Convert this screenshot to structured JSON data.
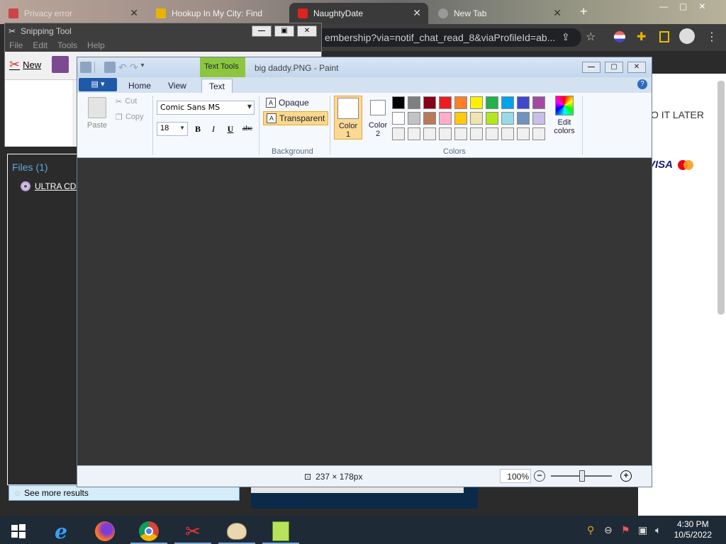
{
  "browser": {
    "tabs": [
      {
        "title": "Privacy error",
        "color": "#c44"
      },
      {
        "title": "Hookup In My City: Find",
        "color": "#e8b400"
      },
      {
        "title": "NaughtyDate",
        "color": "#d22"
      },
      {
        "title": "New Tab",
        "color": "#999"
      }
    ],
    "new_tab": "+",
    "url": "embership?via=notif_chat_read_8&viaProfileId=ab...",
    "page": {
      "later_text": "O IT LATER",
      "visa_text": "VISA"
    }
  },
  "snipping_tool": {
    "title": "Snipping Tool",
    "menu": [
      "File",
      "Edit",
      "Tools",
      "Help"
    ],
    "new_label": "New"
  },
  "start_search": {
    "files_heading": "Files (1)",
    "file_result": "ULTRA CD BLOATWARE",
    "more_results": "See more results"
  },
  "paint": {
    "title": "big daddy.PNG - Paint",
    "context_tab": "Text Tools",
    "tabs": [
      "Home",
      "View",
      "Text"
    ],
    "active_tab": "Text",
    "clipboard": {
      "paste": "Paste",
      "cut": "Cut",
      "copy": "Copy"
    },
    "font": {
      "family": "Comic Sans MS",
      "size": "18"
    },
    "format_buttons": [
      "B",
      "I",
      "U",
      "abc"
    ],
    "background": {
      "label": "Background",
      "opaque": "Opaque",
      "transparent": "Transparent"
    },
    "colors": {
      "label": "Colors",
      "color1": "Color",
      "color1_num": "1",
      "color2": "Color",
      "color2_num": "2",
      "edit": "Edit",
      "edit2": "colors",
      "palette": [
        "#000000",
        "#7f7f7f",
        "#880015",
        "#ed1c24",
        "#ff7f27",
        "#fff200",
        "#22b14c",
        "#00a2e8",
        "#3f48cc",
        "#a349a4",
        "#ffffff",
        "#c3c3c3",
        "#b97a57",
        "#ffaec9",
        "#ffc90e",
        "#efe4b0",
        "#b5e61d",
        "#99d9ea",
        "#7092be",
        "#c8bfe7",
        "#f0f0f0",
        "#f0f0f0",
        "#f0f0f0",
        "#f0f0f0",
        "#f0f0f0",
        "#f0f0f0",
        "#f0f0f0",
        "#f0f0f0",
        "#f0f0f0",
        "#f0f0f0"
      ]
    },
    "status": {
      "dimensions": "237 × 178px",
      "zoom": "100%"
    }
  },
  "taskbar": {
    "apps": [
      "start-icon",
      "internet-explorer-icon",
      "firefox-icon",
      "chrome-icon",
      "snipping-tool-icon",
      "paint-icon",
      "notepad-plus-plus-icon"
    ],
    "clock_time": "4:30 PM",
    "clock_date": "10/5/2022"
  }
}
